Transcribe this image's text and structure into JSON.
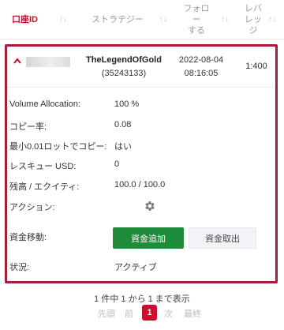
{
  "header": {
    "columns": [
      {
        "label": "口座ID",
        "sort": "↑↓"
      },
      {
        "label": "ストラテジー",
        "sort": "↑↓"
      },
      {
        "label": "フォロー する",
        "sort": "↑↓"
      },
      {
        "label": "レバ レッ ジ",
        "sort": "↑↓"
      }
    ]
  },
  "row": {
    "expand_icon": "chevron-up-icon",
    "strategy_name": "TheLegendOfGold",
    "strategy_id": "(35243133)",
    "follow_date": "2022-08-04",
    "follow_time": "08:16:05",
    "leverage": "1:400"
  },
  "details": {
    "volume_allocation_label": "Volume Allocation:",
    "volume_allocation_value": "100 %",
    "copy_rate_label": "コピー率:",
    "copy_rate_value": "0.08",
    "min_lot_label": "最小0.01ロットでコピー:",
    "min_lot_value": "はい",
    "rescue_label": "レスキュー USD:",
    "rescue_value": "0",
    "balance_label": "残高 / エクイティ:",
    "balance_value": "100.0 / 100.0",
    "action_label": "アクション:",
    "action_icon": "gear-icon",
    "fund_move_label": "資金移動:",
    "add_funds_label": "資金追加",
    "withdraw_label": "資金取出",
    "status_label": "状況:",
    "status_value": "アクティブ"
  },
  "pagination": {
    "summary": "1 件中 1 から 1 まで表示",
    "first": "先頭",
    "prev": "前",
    "current": "1",
    "next": "次",
    "last": "最終"
  },
  "colors": {
    "accent": "#c8102e",
    "border": "#a51d3b",
    "button_green": "#1e8c3a"
  }
}
